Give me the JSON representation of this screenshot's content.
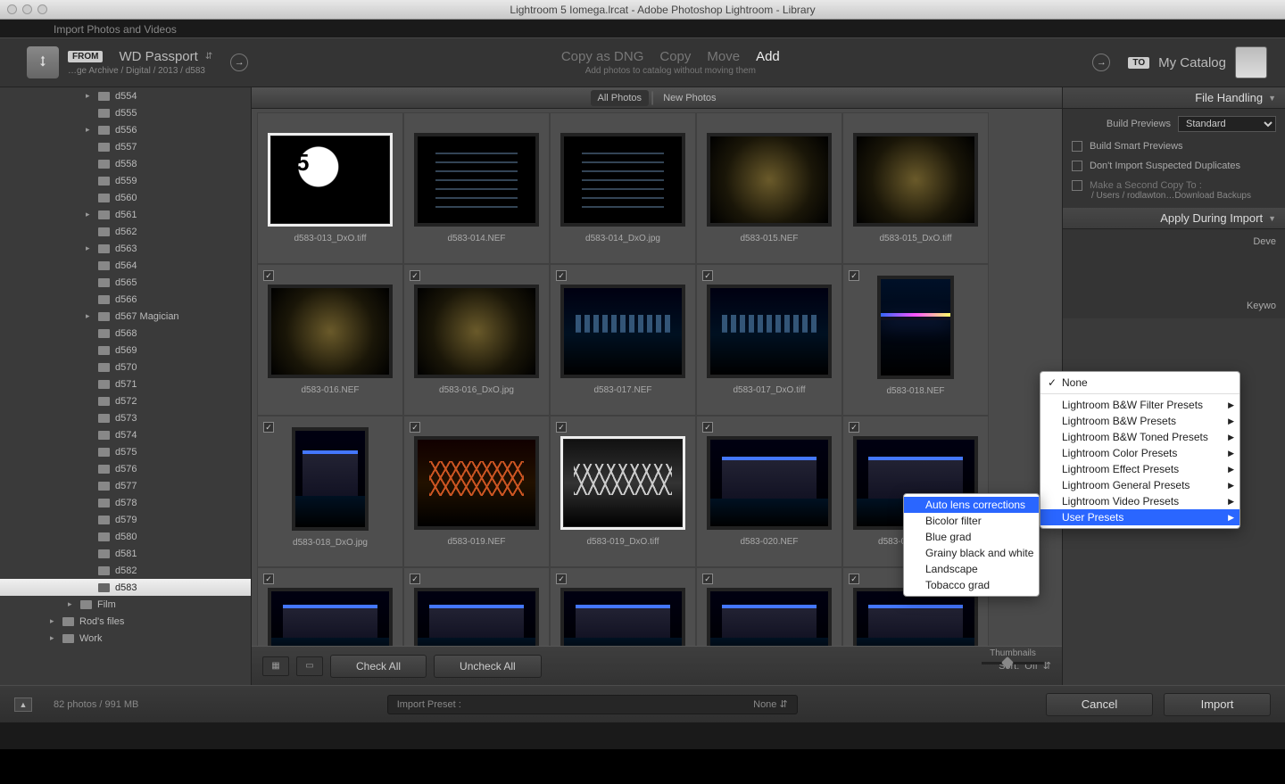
{
  "title": "Lightroom 5 Iomega.lrcat - Adobe Photoshop Lightroom - Library",
  "subtitle": "Import Photos and Videos",
  "source": {
    "from": "FROM",
    "name": "WD Passport",
    "path": "…ge Archive / Digital / 2013 / d583"
  },
  "dest": {
    "to": "TO",
    "name": "My Catalog"
  },
  "modes": {
    "dng": "Copy as DNG",
    "copy": "Copy",
    "move": "Move",
    "add": "Add",
    "sub": "Add photos to catalog without moving them"
  },
  "tabs": {
    "all": "All Photos",
    "new": "New Photos"
  },
  "folders": [
    {
      "n": "d554",
      "a": true
    },
    {
      "n": "d555"
    },
    {
      "n": "d556",
      "a": true
    },
    {
      "n": "d557"
    },
    {
      "n": "d558"
    },
    {
      "n": "d559"
    },
    {
      "n": "d560"
    },
    {
      "n": "d561",
      "a": true
    },
    {
      "n": "d562"
    },
    {
      "n": "d563",
      "a": true
    },
    {
      "n": "d564"
    },
    {
      "n": "d565"
    },
    {
      "n": "d566"
    },
    {
      "n": "d567 Magician",
      "a": true
    },
    {
      "n": "d568"
    },
    {
      "n": "d569"
    },
    {
      "n": "d570"
    },
    {
      "n": "d571"
    },
    {
      "n": "d572"
    },
    {
      "n": "d573"
    },
    {
      "n": "d574"
    },
    {
      "n": "d575"
    },
    {
      "n": "d576"
    },
    {
      "n": "d577"
    },
    {
      "n": "d578"
    },
    {
      "n": "d579"
    },
    {
      "n": "d580"
    },
    {
      "n": "d581"
    },
    {
      "n": "d582"
    },
    {
      "n": "d583",
      "sel": true
    }
  ],
  "rootFolders": [
    {
      "n": "Film",
      "l": 1
    },
    {
      "n": "Rod's files"
    },
    {
      "n": "Work"
    }
  ],
  "thumbs": [
    [
      {
        "f": "d583-013_DxO.tiff",
        "c": "t-mph",
        "sel": true,
        "nc": true
      },
      {
        "f": "d583-014.NEF",
        "c": "t-win",
        "nc": true
      },
      {
        "f": "d583-014_DxO.jpg",
        "c": "t-win",
        "nc": true
      },
      {
        "f": "d583-015.NEF",
        "c": "t-glow",
        "nc": true
      },
      {
        "f": "d583-015_DxO.tiff",
        "c": "t-glow",
        "nc": true
      }
    ],
    [
      {
        "f": "d583-016.NEF",
        "c": "t-glow"
      },
      {
        "f": "d583-016_DxO.jpg",
        "c": "t-glow"
      },
      {
        "f": "d583-017.NEF",
        "c": "t-city"
      },
      {
        "f": "d583-017_DxO.tiff",
        "c": "t-city"
      },
      {
        "f": "d583-018.NEF",
        "c": "t-night",
        "tall": true
      }
    ],
    [
      {
        "f": "d583-018_DxO.jpg",
        "c": "t-bld",
        "tall": true
      },
      {
        "f": "d583-019.NEF",
        "c": "t-bridge"
      },
      {
        "f": "d583-019_DxO.tiff",
        "c": "t-bwbridge",
        "sel": true
      },
      {
        "f": "d583-020.NEF",
        "c": "t-bld"
      },
      {
        "f": "d583-020_DxO.jpg",
        "c": "t-bld"
      }
    ],
    [
      {
        "f": "",
        "c": "t-bld",
        "short": true
      },
      {
        "f": "",
        "c": "t-bld",
        "short": true
      },
      {
        "f": "",
        "c": "t-bld",
        "short": true
      },
      {
        "f": "",
        "c": "t-bld",
        "short": true
      },
      {
        "f": "",
        "c": "t-bld",
        "short": true
      }
    ]
  ],
  "toolbar": {
    "checkAll": "Check All",
    "uncheckAll": "Uncheck All",
    "sort": "Sort:",
    "sortv": "Off",
    "thumbs": "Thumbnails"
  },
  "fileHandling": {
    "title": "File Handling",
    "previews": "Build Previews",
    "previewsVal": "Standard",
    "smart": "Build Smart Previews",
    "dup": "Don't Import Suspected Duplicates",
    "copy": "Make a Second Copy To :",
    "copyPath": "/ Users / rodlawton…Download Backups"
  },
  "applyDuring": {
    "title": "Apply During Import",
    "develop": "Deve",
    "keywords": "Keywo"
  },
  "menu1": {
    "none": "None",
    "items": [
      "Lightroom B&W Filter Presets",
      "Lightroom B&W Presets",
      "Lightroom B&W Toned Presets",
      "Lightroom Color Presets",
      "Lightroom Effect Presets",
      "Lightroom General Presets",
      "Lightroom Video Presets",
      "User Presets"
    ]
  },
  "menu2": [
    "Auto lens corrections",
    "Bicolor filter",
    "Blue grad",
    "Grainy black and white",
    "Landscape",
    "Tobacco grad"
  ],
  "footer": {
    "status": "82 photos / 991 MB",
    "presetL": "Import Preset :",
    "presetV": "None",
    "cancel": "Cancel",
    "import": "Import"
  }
}
